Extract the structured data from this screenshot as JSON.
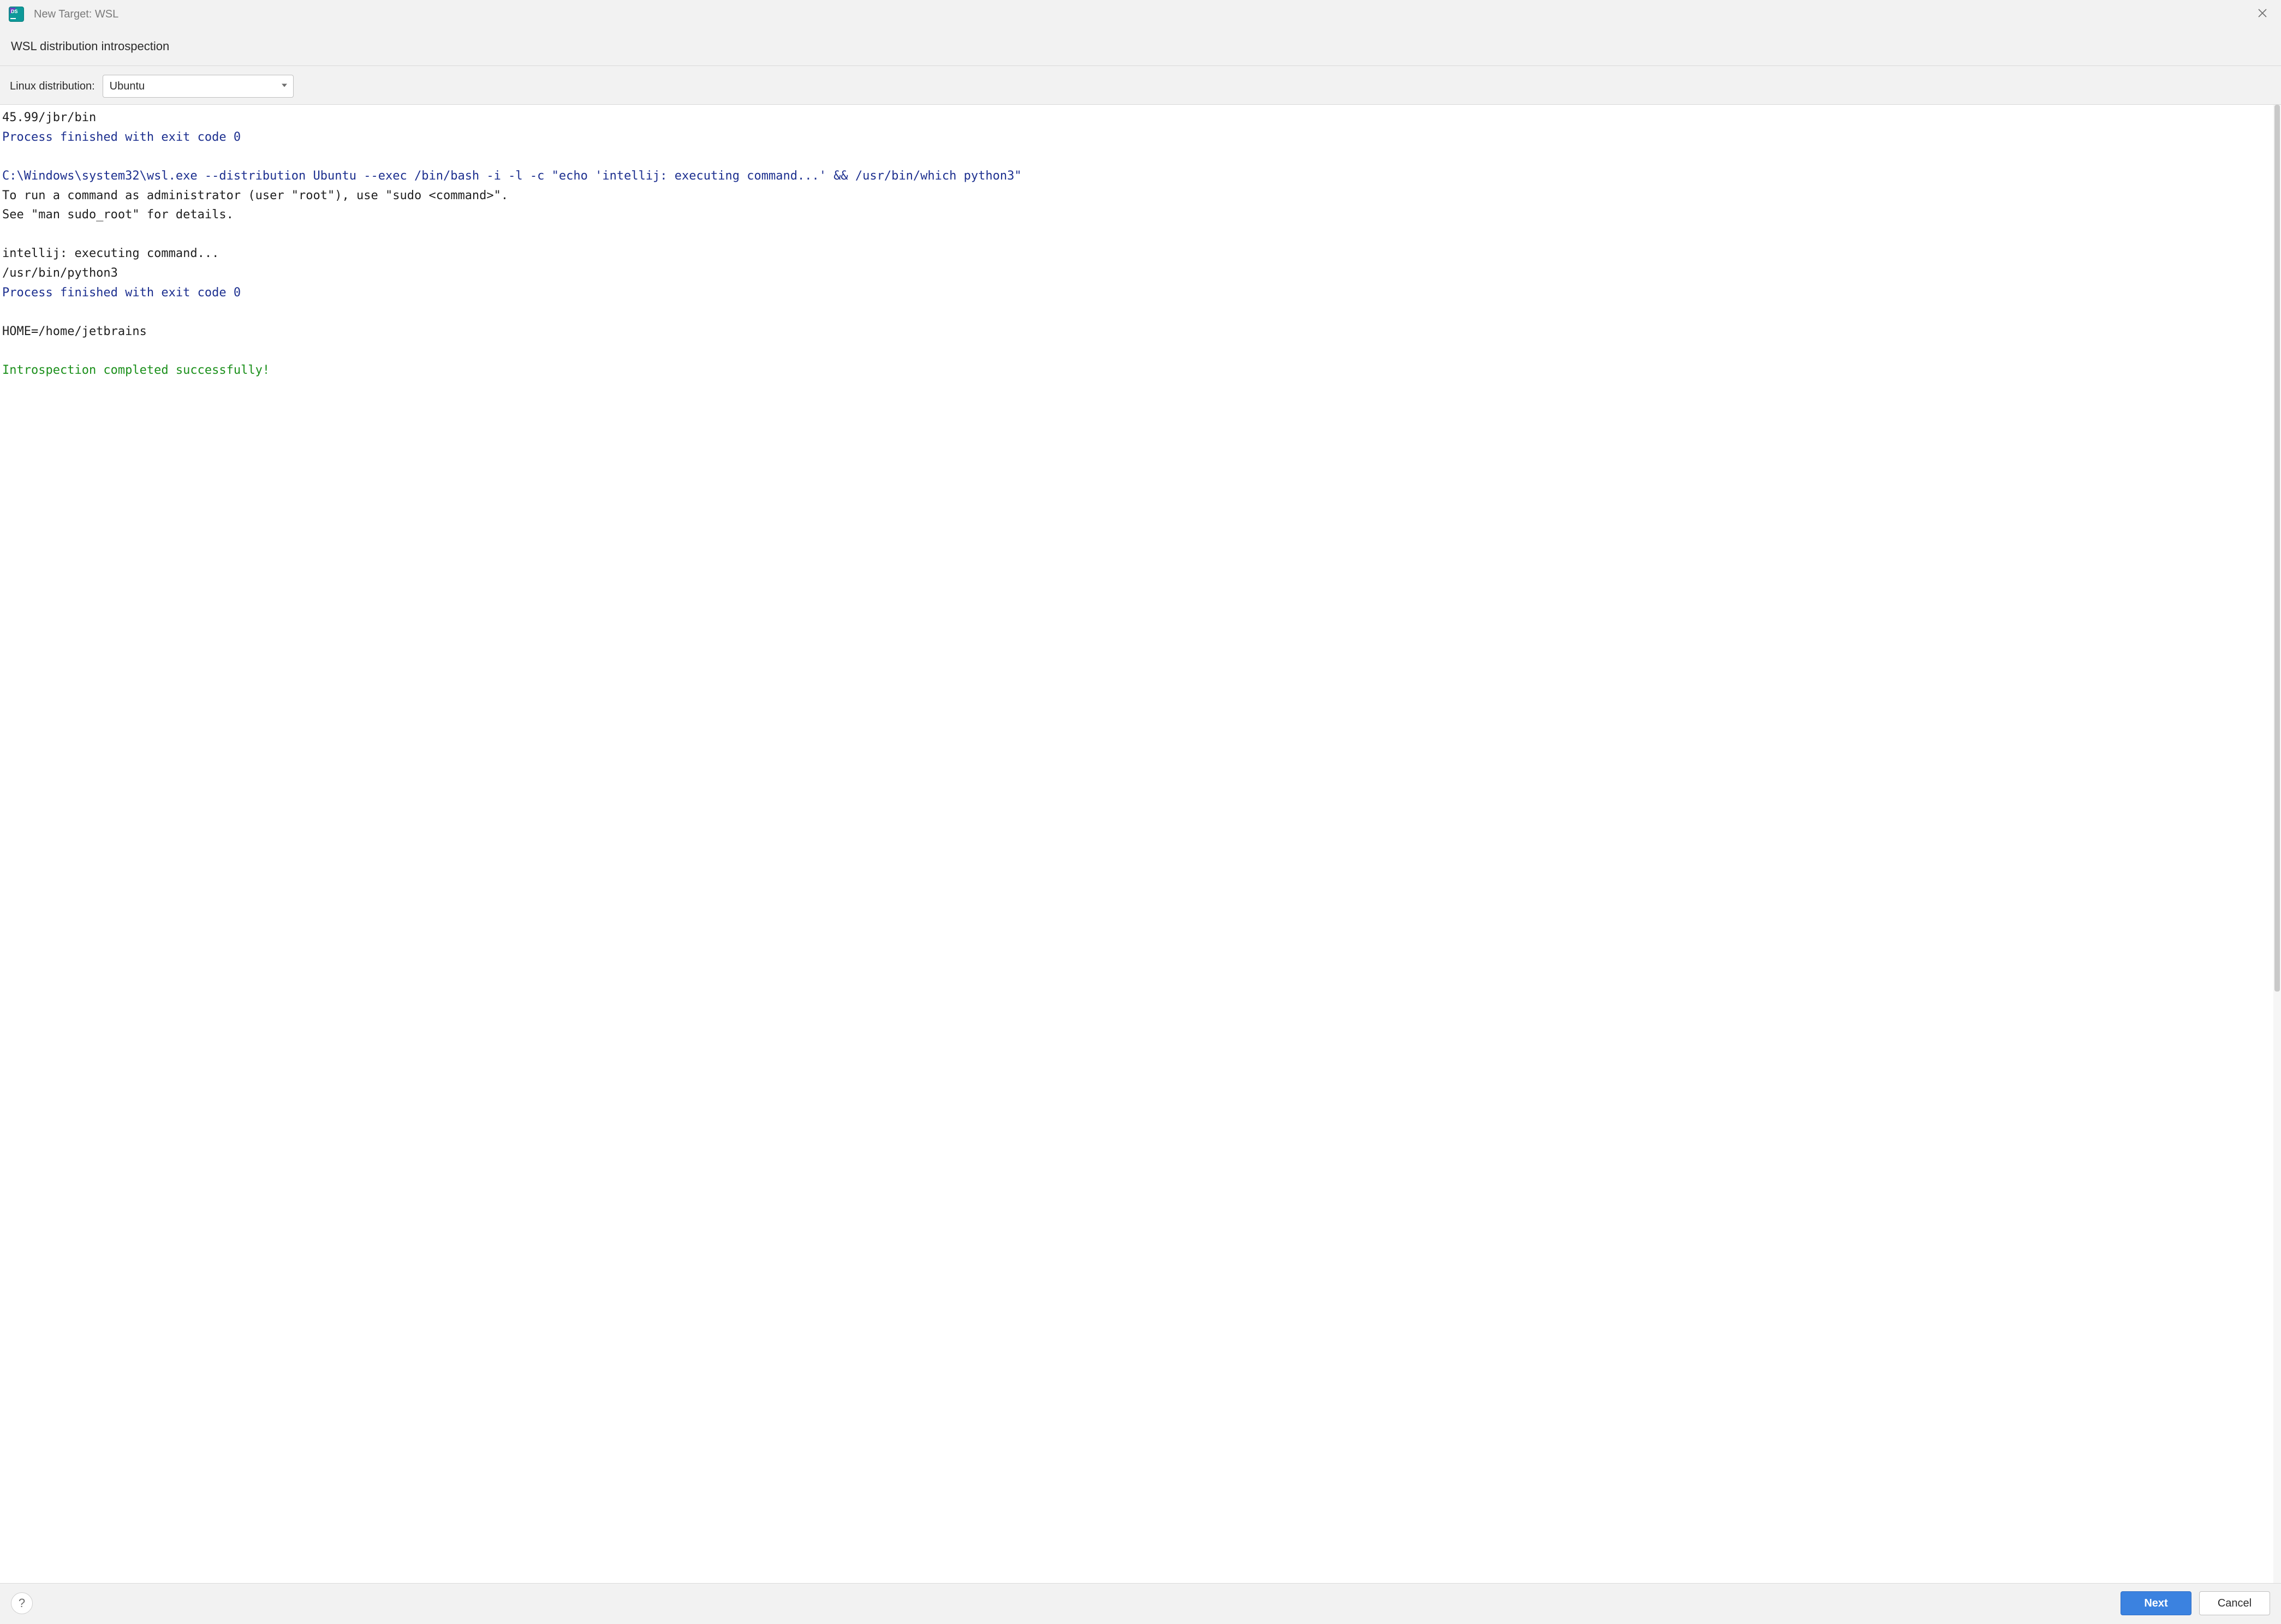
{
  "titlebar": {
    "title": "New Target: WSL"
  },
  "heading": "WSL distribution introspection",
  "config": {
    "label": "Linux distribution:",
    "selected": "Ubuntu"
  },
  "console": {
    "lines": [
      {
        "cls": "black",
        "text": "45.99/jbr/bin"
      },
      {
        "cls": "blue",
        "text": "Process finished with exit code 0"
      },
      {
        "cls": "black",
        "text": ""
      },
      {
        "cls": "blue",
        "text": "C:\\Windows\\system32\\wsl.exe --distribution Ubuntu --exec /bin/bash -i -l -c \"echo 'intellij: executing command...' && /usr/bin/which python3\""
      },
      {
        "cls": "black",
        "text": "To run a command as administrator (user \"root\"), use \"sudo <command>\"."
      },
      {
        "cls": "black",
        "text": "See \"man sudo_root\" for details."
      },
      {
        "cls": "black",
        "text": ""
      },
      {
        "cls": "black",
        "text": "intellij: executing command..."
      },
      {
        "cls": "black",
        "text": "/usr/bin/python3"
      },
      {
        "cls": "blue",
        "text": "Process finished with exit code 0"
      },
      {
        "cls": "black",
        "text": ""
      },
      {
        "cls": "black",
        "text": "HOME=/home/jetbrains"
      },
      {
        "cls": "black",
        "text": ""
      },
      {
        "cls": "green",
        "text": "Introspection completed successfully!"
      }
    ]
  },
  "footer": {
    "help": "?",
    "next": "Next",
    "cancel": "Cancel"
  }
}
